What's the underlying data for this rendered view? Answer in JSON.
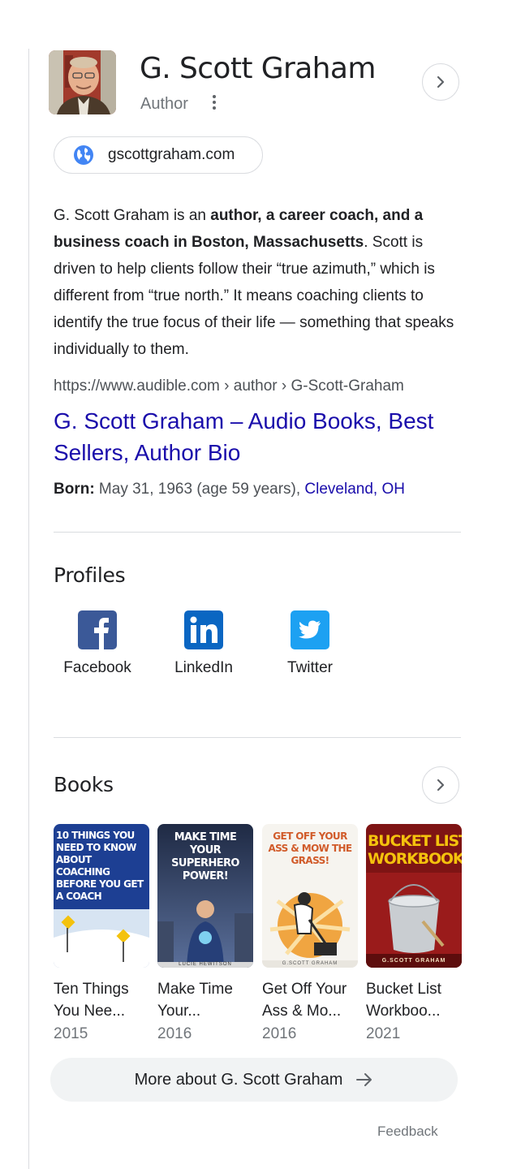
{
  "header": {
    "title": "G. Scott Graham",
    "subtitle": "Author"
  },
  "website": {
    "label": "gscottgraham.com",
    "icon": "globe-icon"
  },
  "description": {
    "part1": "G. Scott Graham is an ",
    "bold": "author, a career coach, and a business coach in Boston, Massachusetts",
    "part2": ". Scott is driven to help clients follow their “true azimuth,” which is different from “true north.” It means coaching clients to identify the true focus of their life — something that speaks individually to them."
  },
  "source": {
    "url": "https://www.audible.com › author › G-Scott-Graham",
    "link": "G. Scott Graham – Audio Books, Best Sellers, Author Bio"
  },
  "born": {
    "label": "Born:",
    "value": " May 31, 1963 (age 59 years), ",
    "place": "Cleveland, OH"
  },
  "profiles": {
    "heading": "Profiles",
    "items": [
      {
        "label": "Facebook",
        "icon": "facebook-icon",
        "color": "#3b5998"
      },
      {
        "label": "LinkedIn",
        "icon": "linkedin-icon",
        "color": "#0a66c2"
      },
      {
        "label": "Twitter",
        "icon": "twitter-icon",
        "color": "#1da1f2"
      }
    ]
  },
  "books": {
    "heading": "Books",
    "items": [
      {
        "title": "Ten Things You Nee...",
        "year": "2015",
        "cover_text": "10 THINGS YOU NEED TO KNOW ABOUT COACHING BEFORE YOU GET A COACH"
      },
      {
        "title": "Make Time Your...",
        "year": "2016",
        "cover_text": "MAKE TIME YOUR SUPERHERO POWER!",
        "cover_author": "LUCIE HEWITSON"
      },
      {
        "title": "Get Off Your Ass & Mo...",
        "year": "2016",
        "cover_text": "GET OFF YOUR ASS & MOW THE GRASS!",
        "cover_author": "G.SCOTT GRAHAM"
      },
      {
        "title": "Bucket List Workboo...",
        "year": "2021",
        "cover_text": "BUCKET LIST WORKBOOK",
        "cover_author": "G.SCOTT GRAHAM"
      }
    ]
  },
  "more_button": "More about G. Scott Graham",
  "feedback": "Feedback",
  "colors": {
    "link": "#1a0dab",
    "text": "#202124",
    "muted": "#70757a",
    "border": "#dadce0",
    "button_bg": "#f1f3f4",
    "globe": "#4285f4"
  }
}
